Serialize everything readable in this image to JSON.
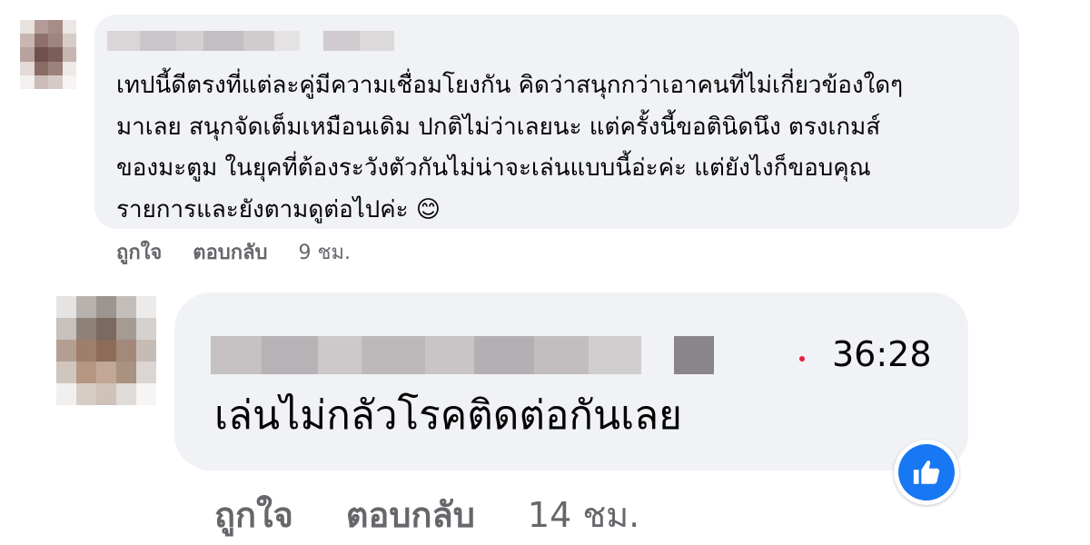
{
  "comment1": {
    "text": "เทปนี้ดีตรงที่แต่ละคู่มีความเชื่อมโยงกัน คิดว่าสนุกกว่าเอาคนที่ไม่เกี่ยวข้องใดๆ\nมาเลย สนุกจัดเต็มเหมือนเดิม ปกติไม่ว่าเลยนะ แต่ครั้งนี้ขอตินิดนึง ตรงเกมส์\nของมะตูม ในยุคที่ต้องระวังตัวกันไม่น่าจะเล่นแบบนี้อ่ะค่ะ แต่ยังไงก็ขอบคุณ\nรายการและยังตามดูต่อไปค่ะ 😊",
    "like_label": "ถูกใจ",
    "reply_label": "ตอบกลับ",
    "timestamp": "9 ชม."
  },
  "comment2": {
    "media_time": "36:28",
    "text": "เล่นไม่กลัวโรคติดต่อกันเลย",
    "like_label": "ถูกใจ",
    "reply_label": "ตอบกลับ",
    "timestamp": "14 ชม."
  },
  "colors": {
    "bubble": "#f0f2f5",
    "secondary_text": "#65676b",
    "like_blue": "#1877f2",
    "dot_red": "#e41e3f"
  },
  "icons": {
    "reaction": "thumbs-up-icon"
  }
}
